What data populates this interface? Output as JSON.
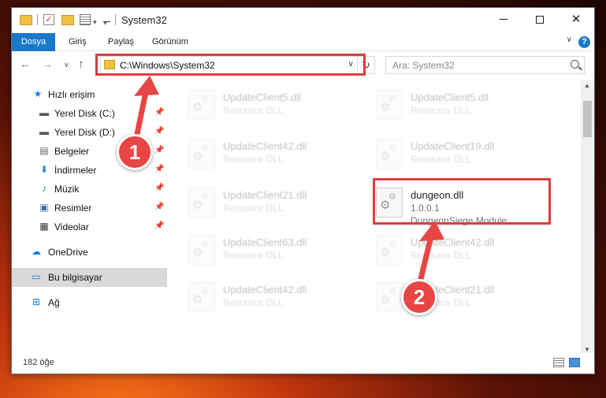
{
  "window": {
    "title": "System32"
  },
  "titlebar": {
    "minimize": "─",
    "close": "✕",
    "dropdown": "▾"
  },
  "ribbon": {
    "tabs": [
      "Dosya",
      "Giriş",
      "Paylaş",
      "Görünüm"
    ],
    "collapse": "∨",
    "help": "?"
  },
  "navigation": {
    "back": "←",
    "forward": "→",
    "recent": "∨",
    "up": "↑",
    "address": "C:\\Windows\\System32",
    "address_dropdown": "∨",
    "refresh": "↻",
    "search_placeholder": "Ara: System32"
  },
  "sidebar": {
    "items": [
      {
        "label": "Hızlı erişim",
        "icon": "star-icon",
        "pinned": false
      },
      {
        "label": "Yerel Disk (C:)",
        "icon": "drive-icon",
        "pinned": true
      },
      {
        "label": "Yerel Disk (D:)",
        "icon": "drive-icon",
        "pinned": true
      },
      {
        "label": "Belgeler",
        "icon": "document-icon",
        "pinned": true
      },
      {
        "label": "İndirmeler",
        "icon": "download-icon",
        "pinned": true
      },
      {
        "label": "Müzik",
        "icon": "music-icon",
        "pinned": true
      },
      {
        "label": "Resimler",
        "icon": "picture-icon",
        "pinned": true
      },
      {
        "label": "Videolar",
        "icon": "video-icon",
        "pinned": true
      },
      {
        "label": "OneDrive",
        "icon": "cloud-icon",
        "pinned": false
      },
      {
        "label": "Bu bilgisayar",
        "icon": "computer-icon",
        "pinned": false,
        "selected": true
      },
      {
        "label": "Ağ",
        "icon": "network-icon",
        "pinned": false
      }
    ],
    "pin_glyph": "📌"
  },
  "files": {
    "left": [
      {
        "name": "UpdateClient5.dll",
        "desc": "Resource DLL"
      },
      {
        "name": "UpdateClient42.dll",
        "desc": "Resource DLL"
      },
      {
        "name": "UpdateClient21.dll",
        "desc": "Resource DLL"
      },
      {
        "name": "UpdateClient63.dll",
        "desc": "Resource DLL"
      },
      {
        "name": "UpdateClient42.dll",
        "desc": "Resource DLL"
      }
    ],
    "right": [
      {
        "name": "UpdateClient5.dll",
        "desc": "Resource DLL"
      },
      {
        "name": "UpdateClient19.dll",
        "desc": "Resource DLL"
      },
      {
        "name": "UpdateClient42.dll",
        "desc": "Resource DLL"
      },
      {
        "name": "UpdateClient21.dll",
        "desc": "Resource DLL"
      }
    ],
    "highlighted": {
      "name": "dungeon.dll",
      "version": "1.0.0.1",
      "desc": "DungeonSiege Module"
    }
  },
  "scrollbar": {
    "up": "▲",
    "down": "▼"
  },
  "status": {
    "item_count": "182 öğe"
  },
  "callouts": {
    "step1": "1",
    "step2": "2"
  },
  "colors": {
    "accent": "#1979ca",
    "highlight": "#e03c3c",
    "badge": "#e84545"
  }
}
